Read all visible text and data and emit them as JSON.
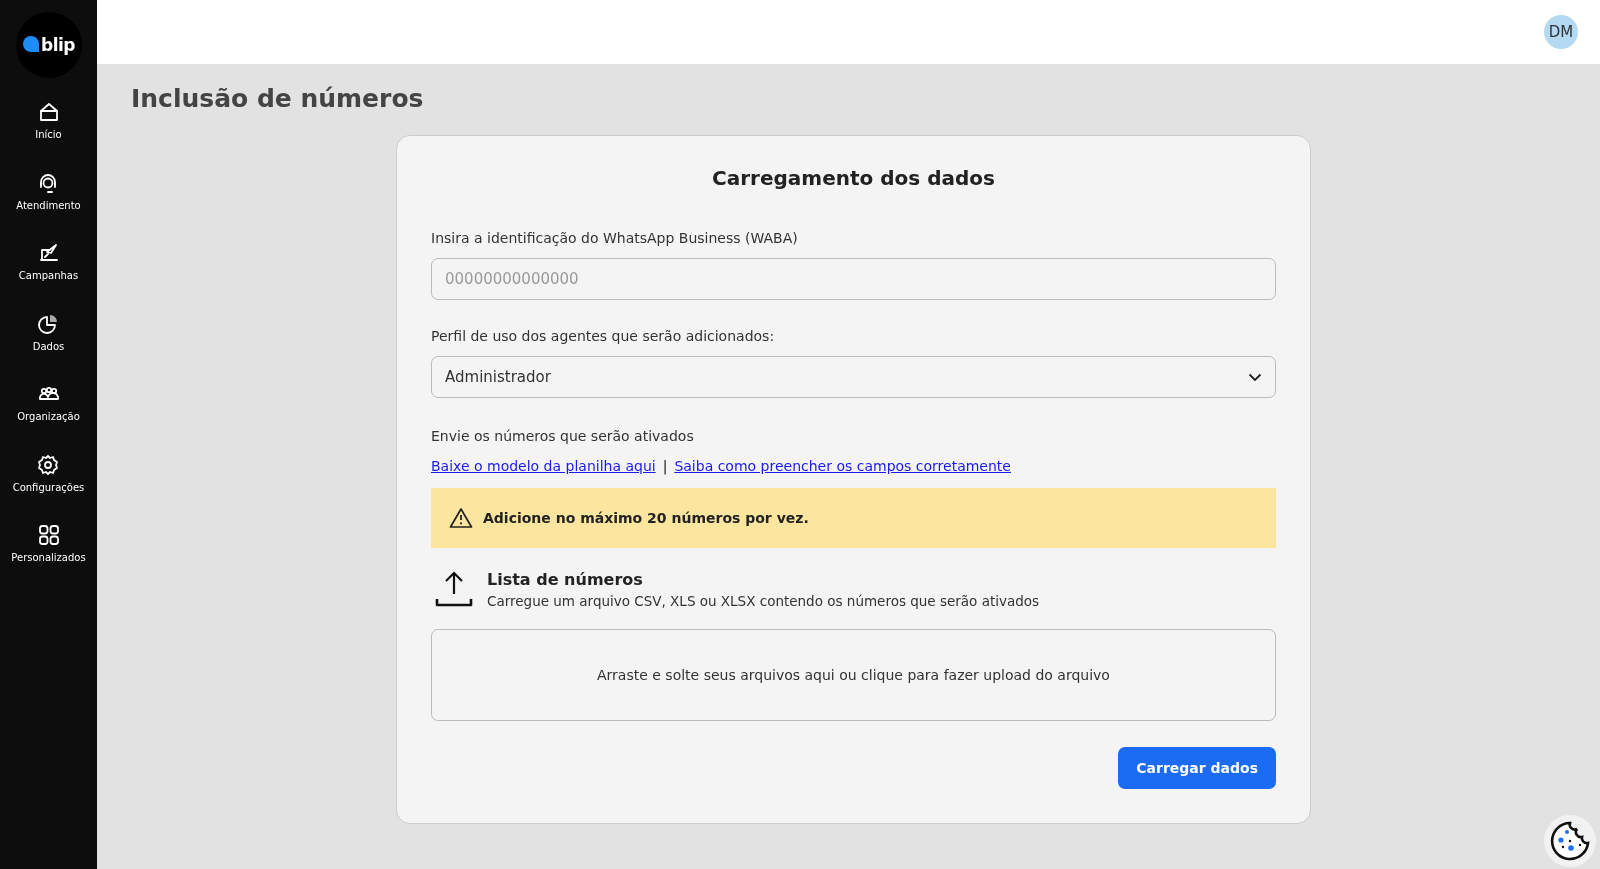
{
  "sidebar": {
    "logo": "blip",
    "items": [
      {
        "label": "Início"
      },
      {
        "label": "Atendimento"
      },
      {
        "label": "Campanhas"
      },
      {
        "label": "Dados"
      },
      {
        "label": "Organização"
      },
      {
        "label": "Configurações"
      },
      {
        "label": "Personalizados"
      }
    ]
  },
  "header": {
    "avatar": "DM"
  },
  "page_title": "Inclusão de números",
  "card": {
    "title": "Carregamento dos dados",
    "waba_label": "Insira a identificação do WhatsApp Business (WABA)",
    "waba_placeholder": "00000000000000",
    "profile_label": "Perfil de uso dos agentes que serão adicionados:",
    "profile_value": "Administrador",
    "send_label": "Envie os números que serão ativados",
    "links": [
      "Baixe o modelo da planilha aqui",
      "Saiba como preencher os campos corretamente"
    ],
    "link_separator": "|",
    "warning": "Adicione no máximo 20 números por vez.",
    "upload_title": "Lista de números",
    "upload_desc": "Carregue um arquivo CSV, XLS ou XLSX contendo os números que serão ativados",
    "dropzone": "Arraste e solte seus arquivos aqui ou clique para fazer upload do arquivo",
    "submit": "Carregar dados"
  }
}
